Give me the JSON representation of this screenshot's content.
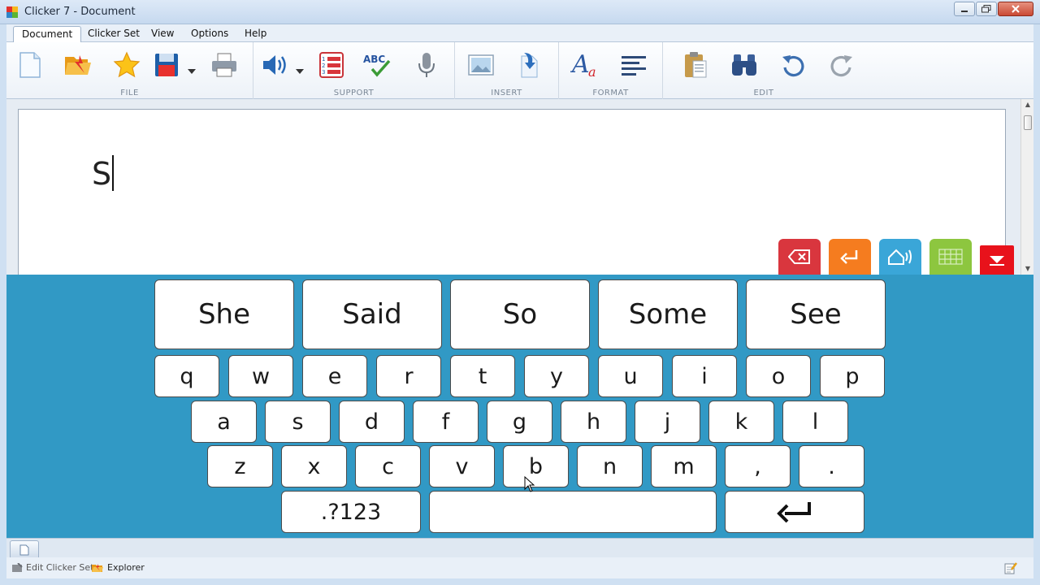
{
  "window": {
    "title": "Clicker 7 - Document"
  },
  "menu": {
    "items": [
      {
        "label": "Document",
        "active": true
      },
      {
        "label": "Clicker Set"
      },
      {
        "label": "View"
      },
      {
        "label": "Options"
      },
      {
        "label": "Help"
      }
    ]
  },
  "ribbon": {
    "groups": {
      "file": "FILE",
      "support": "SUPPORT",
      "insert": "INSERT",
      "format": "FORMAT",
      "edit": "EDIT"
    },
    "spell_check_label": "ABC"
  },
  "document": {
    "text": "S"
  },
  "colors": {
    "keyboard_bg": "#3199c5",
    "backspace": "#d9363e",
    "enter": "#f57c1f",
    "speak": "#3aa6d8",
    "grid": "#8dc63f",
    "hide": "#e8121b"
  },
  "keyboard": {
    "words": [
      "She",
      "Said",
      "So",
      "Some",
      "See"
    ],
    "row1": [
      "q",
      "w",
      "e",
      "r",
      "t",
      "y",
      "u",
      "i",
      "o",
      "p"
    ],
    "row2": [
      "a",
      "s",
      "d",
      "f",
      "g",
      "h",
      "j",
      "k",
      "l"
    ],
    "row3": [
      "z",
      "x",
      "c",
      "v",
      "b",
      "n",
      "m",
      ",",
      "."
    ],
    "symbols_label": ".?123",
    "enter_symbol": "↵"
  },
  "statusbar": {
    "edit_set_label": "Edit Clicker Set",
    "explorer_label": "Explorer"
  }
}
